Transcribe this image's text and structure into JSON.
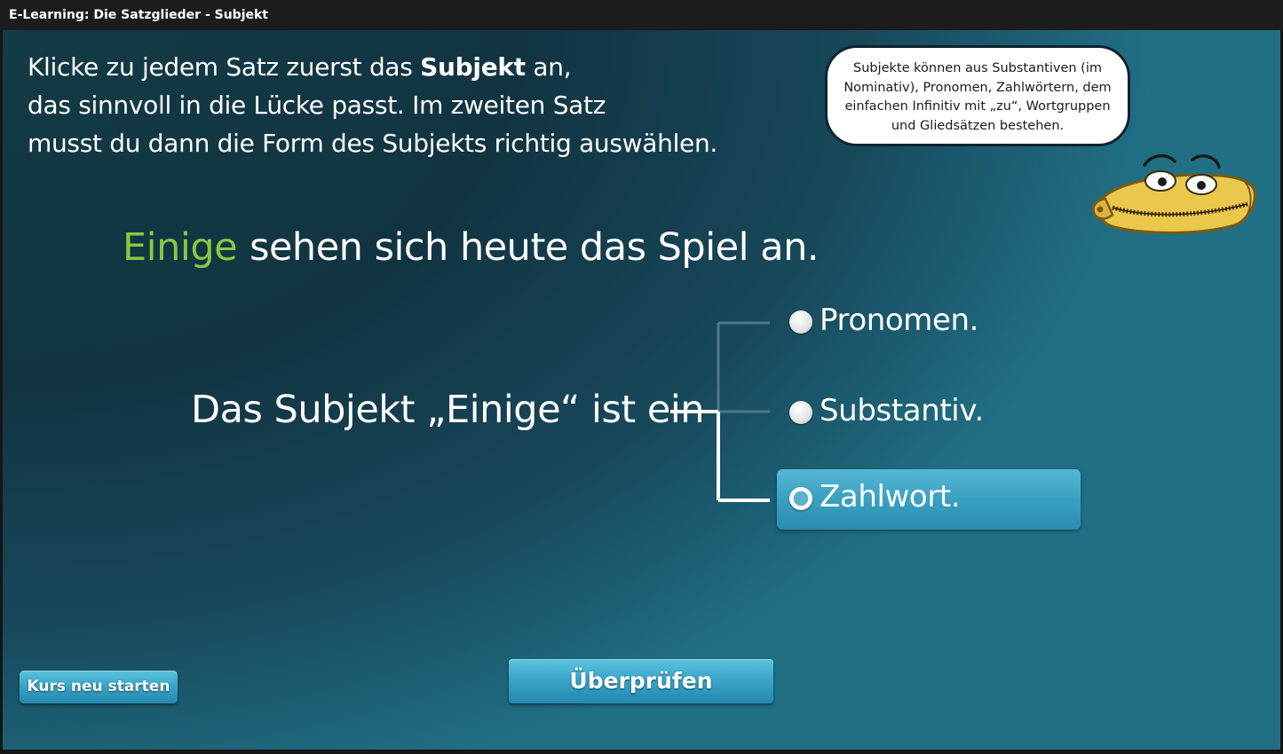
{
  "window": {
    "title": "E-Learning: Die Satzglieder - Subjekt"
  },
  "instruction": {
    "line1_prefix": "Klicke zu jedem Satz zuerst das ",
    "line1_bold": "Subjekt",
    "line1_suffix": " an,",
    "line2": "das sinnvoll in die Lücke passt. Im zweiten Satz",
    "line3": "musst du dann die Form des Subjekts richtig auswählen."
  },
  "hint_bubble": {
    "text_line1": "Subjekte können aus Substantiven (im",
    "text_line2": "Nominativ), Pronomen, Zahlwörtern, dem",
    "text_line3": "einfachen Infinitiv mit „zu“, Wortgruppen",
    "text_line4": "und Gliedsätzen bestehen."
  },
  "sentence": {
    "answer": "Einige",
    "rest": "sehen sich heute das Spiel an."
  },
  "question": {
    "text": "Das Subjekt „Einige“ ist ein"
  },
  "options": [
    {
      "label": "Pronomen.",
      "selected": false
    },
    {
      "label": "Substantiv.",
      "selected": false
    },
    {
      "label": "Zahlwort.",
      "selected": true
    }
  ],
  "buttons": {
    "check": "Überprüfen",
    "restart": "Kurs neu starten"
  },
  "colors": {
    "answer_green": "#8cc63f",
    "accent_blue": "#3aa6c9",
    "mascot_yellow": "#e8c84a"
  },
  "icons": {
    "mascot": "zipper-mascot-icon",
    "radio": "radio-button-icon"
  }
}
